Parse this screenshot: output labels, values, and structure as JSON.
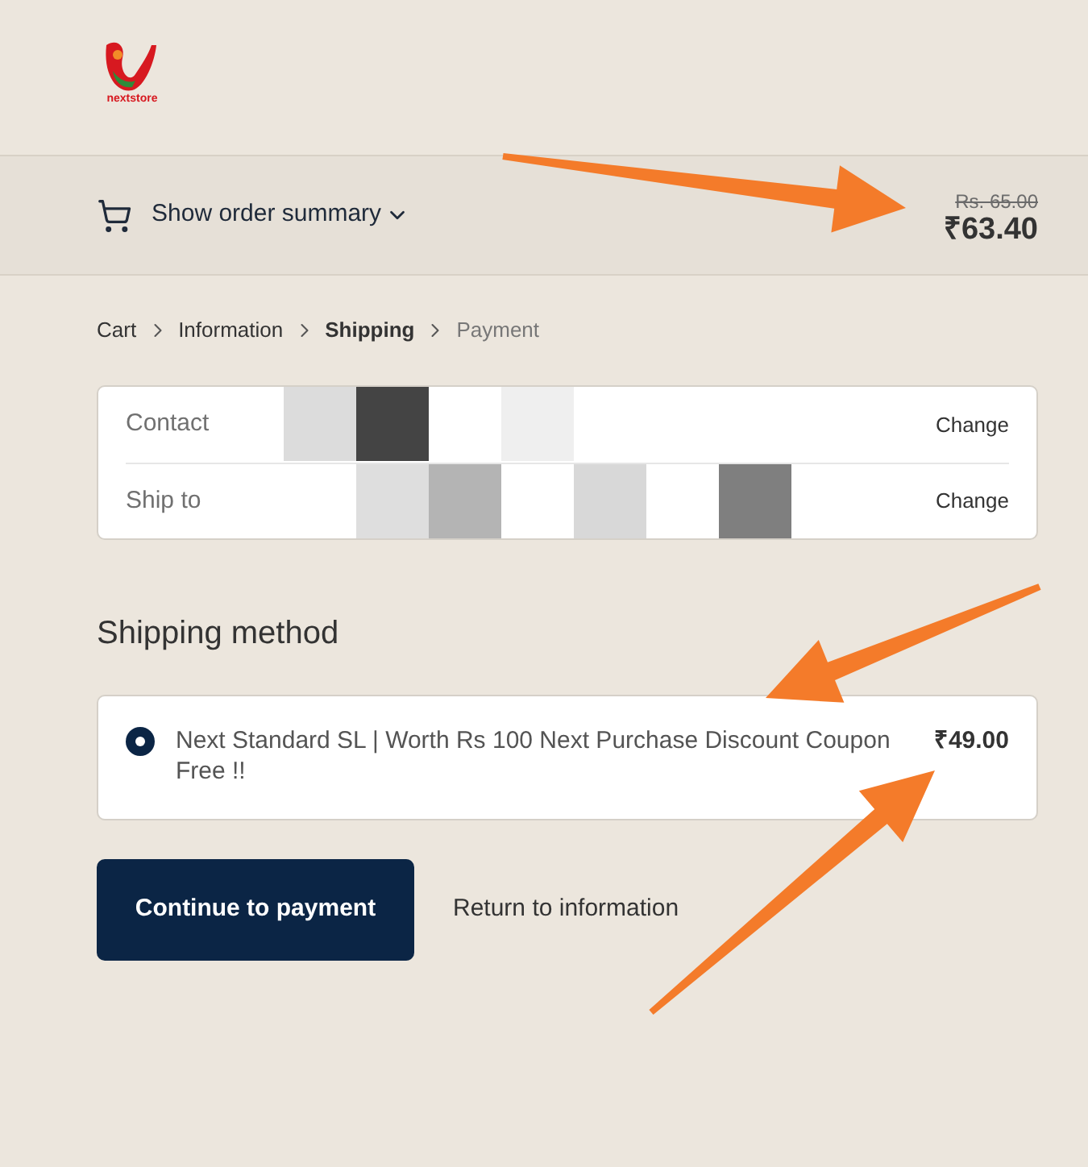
{
  "logo": {
    "text": "nextstore"
  },
  "order_summary": {
    "label": "Show order summary",
    "original_price": "Rs. 65.00",
    "price": "₹63.40"
  },
  "breadcrumb": [
    {
      "label": "Cart",
      "selected": false,
      "disabled": false
    },
    {
      "label": "Information",
      "selected": false,
      "disabled": false
    },
    {
      "label": "Shipping",
      "selected": true,
      "disabled": false
    },
    {
      "label": "Payment",
      "selected": false,
      "disabled": true
    }
  ],
  "review": [
    {
      "label": "Contact",
      "action": "Change"
    },
    {
      "label": "Ship to",
      "action": "Change"
    }
  ],
  "shipping_method": {
    "heading": "Shipping method",
    "options": [
      {
        "label": "Next Standard SL | Worth Rs 100 Next Purchase Discount Coupon Free !!",
        "price": "₹49.00",
        "selected": true
      }
    ]
  },
  "actions": {
    "primary": "Continue to payment",
    "secondary": "Return to information"
  }
}
